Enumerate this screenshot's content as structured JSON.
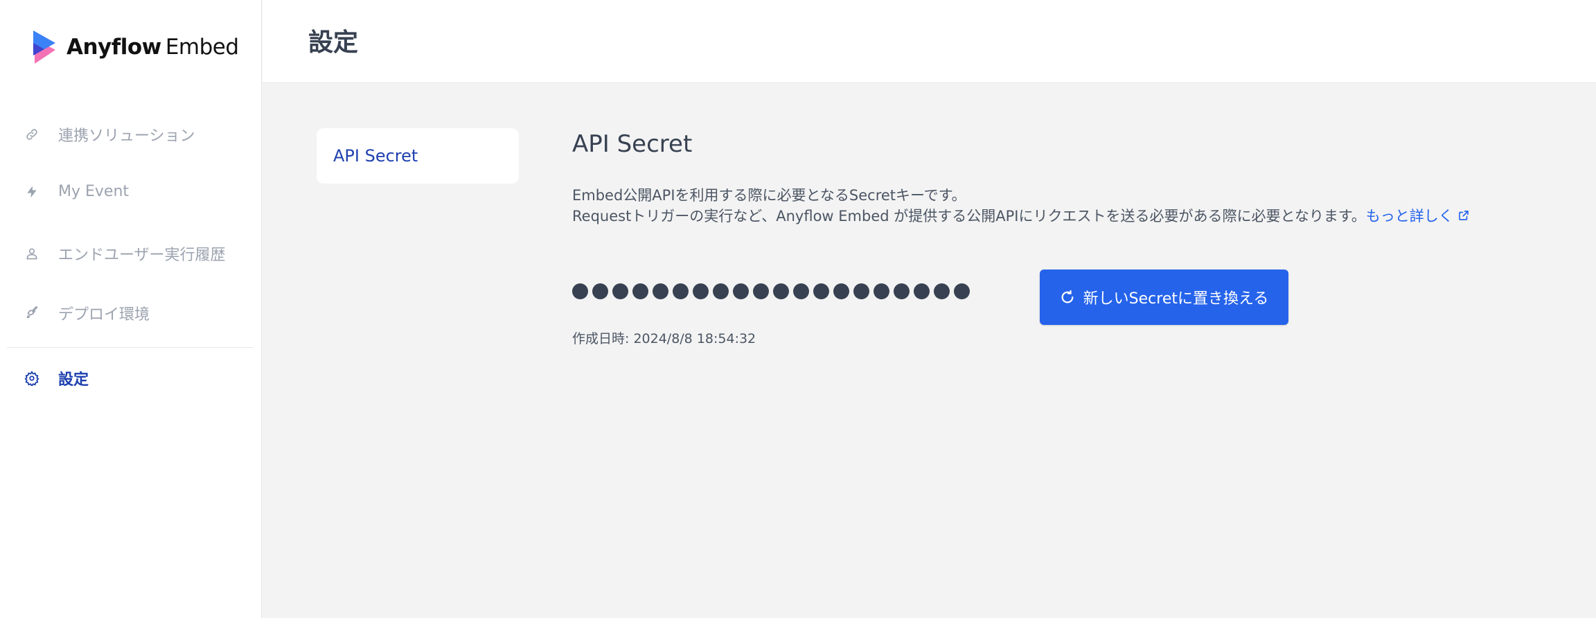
{
  "app": {
    "logo_bold": "Anyflow",
    "logo_light": "Embed"
  },
  "sidebar": {
    "items": [
      {
        "label": "連携ソリューション",
        "icon": "link-icon"
      },
      {
        "label": "My Event",
        "icon": "bolt-icon"
      },
      {
        "label": "エンドユーザー実行履歴",
        "icon": "user-icon"
      },
      {
        "label": "デプロイ環境",
        "icon": "rocket-icon"
      },
      {
        "label": "設定",
        "icon": "gear-icon",
        "active": true
      }
    ]
  },
  "header": {
    "title": "設定"
  },
  "settings_nav": {
    "items": [
      {
        "label": "API Secret",
        "active": true
      }
    ]
  },
  "api_secret": {
    "title": "API Secret",
    "description_line1": "Embed公開APIを利用する際に必要となるSecretキーです。",
    "description_line2": "Requestトリガーの実行など、Anyflow Embed が提供する公開APIにリクエストを送る必要がある際に必要となります。",
    "more_link": "もっと詳しく",
    "masked_secret_length": 20,
    "replace_button": "新しいSecretに置き換える",
    "created_at": "作成日時: 2024/8/8 18:54:32"
  },
  "colors": {
    "accent": "#2563eb",
    "active_nav": "#1e40af",
    "inactive_nav": "#9ca3af",
    "content_bg": "#f3f3f3"
  }
}
